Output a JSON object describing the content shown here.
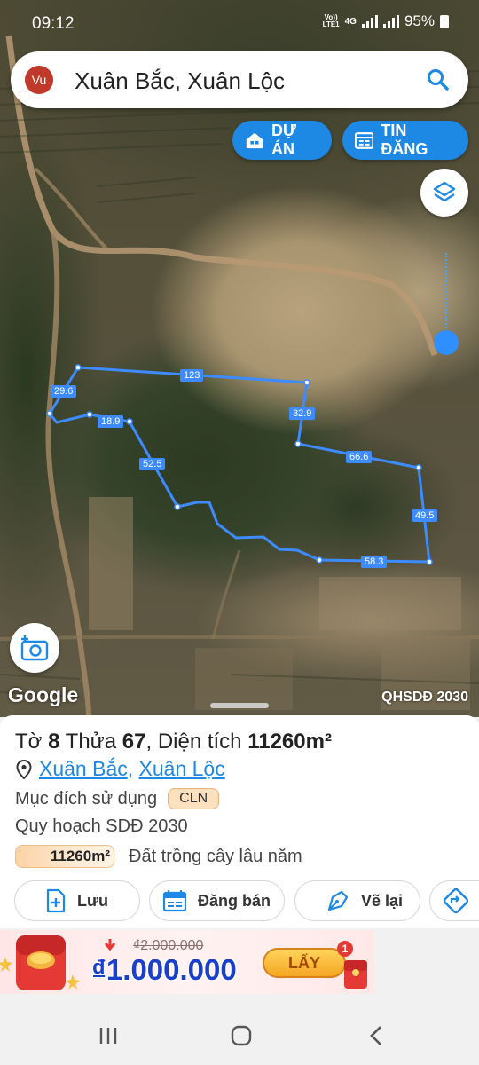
{
  "status_bar": {
    "time": "09:12",
    "network": [
      "Vo))",
      "LTE1"
    ],
    "network_type": "4G",
    "battery": "95%"
  },
  "search": {
    "avatar_text": "Vu",
    "query": "Xuân Bắc, Xuân Lộc"
  },
  "map_buttons": {
    "project": "DỰ ÁN",
    "listing": "TIN ĐĂNG"
  },
  "map": {
    "attribution": "Google",
    "layer_label": "QHSDĐ 2030",
    "edge_lengths": [
      "123",
      "29.6",
      "32.9",
      "18.9",
      "66.6",
      "52.5",
      "49.5",
      "58.3"
    ]
  },
  "plot": {
    "sheet_label": "Tờ",
    "sheet_number": "8",
    "parcel_label": "Thửa",
    "parcel_number": "67",
    "area_label": "Diện tích",
    "area_value": "11260m²",
    "commune": "Xuân Bắc",
    "district": "Xuân Lộc",
    "purpose_label": "Mục đích sử dụng",
    "purpose_code": "CLN",
    "planning_label": "Quy hoạch SDĐ 2030",
    "planning_area": "11260m²",
    "planning_use": "Đất trồng cây lâu năm"
  },
  "actions": {
    "save": "Lưu",
    "sell": "Đăng bán",
    "redraw": "Vẽ lại"
  },
  "promo": {
    "old_price": "₫2.000.000",
    "new_price": "₫1.000.000",
    "claim": "LẤY",
    "claim_badge": "1"
  },
  "colors": {
    "accent": "#1e88e5",
    "boundary": "#3d8bff",
    "avatar": "#c0392b"
  }
}
